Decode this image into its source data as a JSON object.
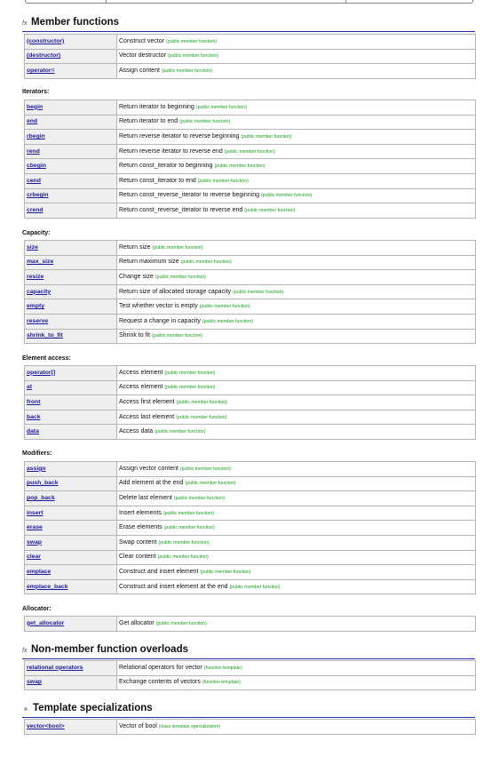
{
  "sections": [
    {
      "title": "Member functions",
      "icon": "fx-icon",
      "groups": [
        {
          "label": "",
          "rows": [
            {
              "name": "(constructor)",
              "desc": "Construct vector",
              "tag": "(public member function)"
            },
            {
              "name": "(destructor)",
              "desc": "Vector destructor",
              "tag": "(public member function)"
            },
            {
              "name": "operator=",
              "desc": "Assign content",
              "tag": "(public member function)"
            }
          ]
        },
        {
          "label": "Iterators:",
          "rows": [
            {
              "name": "begin",
              "desc": "Return iterator to beginning",
              "tag": "(public member function)"
            },
            {
              "name": "end",
              "desc": "Return iterator to end",
              "tag": "(public member function)"
            },
            {
              "name": "rbegin",
              "desc": "Return reverse iterator to reverse beginning",
              "tag": "(public member function)"
            },
            {
              "name": "rend",
              "desc": "Return reverse iterator to reverse end",
              "tag": "(public member function)"
            },
            {
              "name": "cbegin",
              "desc": "Return const_iterator to beginning",
              "tag": "(public member function)"
            },
            {
              "name": "cend",
              "desc": "Return const_iterator to end",
              "tag": "(public member function)"
            },
            {
              "name": "crbegin",
              "desc": "Return const_reverse_iterator to reverse beginning",
              "tag": "(public member function)"
            },
            {
              "name": "crend",
              "desc": "Return const_reverse_iterator to reverse end",
              "tag": "(public member function)"
            }
          ]
        },
        {
          "label": "Capacity:",
          "rows": [
            {
              "name": "size",
              "desc": "Return size",
              "tag": "(public member function)"
            },
            {
              "name": "max_size",
              "desc": "Return maximum size",
              "tag": "(public member function)"
            },
            {
              "name": "resize",
              "desc": "Change size",
              "tag": "(public member function)"
            },
            {
              "name": "capacity",
              "desc": "Return size of allocated storage capacity",
              "tag": "(public member function)"
            },
            {
              "name": "empty",
              "desc": "Test whether vector is empty",
              "tag": "(public member function)"
            },
            {
              "name": "reserve",
              "desc": "Request a change in capacity",
              "tag": "(public member function)"
            },
            {
              "name": "shrink_to_fit",
              "desc": "Shrink to fit",
              "tag": "(public member function)"
            }
          ]
        },
        {
          "label": "Element access:",
          "rows": [
            {
              "name": "operator[]",
              "desc": "Access element",
              "tag": "(public member function)"
            },
            {
              "name": "at",
              "desc": "Access element",
              "tag": "(public member function)"
            },
            {
              "name": "front",
              "desc": "Access first element",
              "tag": "(public member function)"
            },
            {
              "name": "back",
              "desc": "Access last element",
              "tag": "(public member function)"
            },
            {
              "name": "data",
              "desc": "Access data",
              "tag": "(public member function)"
            }
          ]
        },
        {
          "label": "Modifiers:",
          "rows": [
            {
              "name": "assign",
              "desc": "Assign vector content",
              "tag": "(public member function)"
            },
            {
              "name": "push_back",
              "desc": "Add element at the end",
              "tag": "(public member function)"
            },
            {
              "name": "pop_back",
              "desc": "Delete last element",
              "tag": "(public member function)"
            },
            {
              "name": "insert",
              "desc": "Insert elements",
              "tag": "(public member function)"
            },
            {
              "name": "erase",
              "desc": "Erase elements",
              "tag": "(public member function)"
            },
            {
              "name": "swap",
              "desc": "Swap content",
              "tag": "(public member function)"
            },
            {
              "name": "clear",
              "desc": "Clear content",
              "tag": "(public member function)"
            },
            {
              "name": "emplace",
              "desc": "Construct and insert element",
              "tag": "(public member function)"
            },
            {
              "name": "emplace_back",
              "desc": "Construct and insert element at the end",
              "tag": "(public member function)"
            }
          ]
        },
        {
          "label": "Allocator:",
          "rows": [
            {
              "name": "get_allocator",
              "desc": "Get allocator",
              "tag": "(public member function)"
            }
          ]
        }
      ]
    },
    {
      "title": "Non-member function overloads",
      "icon": "fx-icon",
      "groups": [
        {
          "label": "",
          "rows": [
            {
              "name": "relational operators",
              "desc": "Relational operators for vector",
              "tag": "(function template)"
            },
            {
              "name": "swap",
              "desc": "Exchange contents of vectors",
              "tag": "(function template)"
            }
          ]
        }
      ]
    },
    {
      "title": "Template specializations",
      "icon": "bullet-icon",
      "groups": [
        {
          "label": "",
          "rows": [
            {
              "name": "vector<bool>",
              "desc": "Vector of bool",
              "tag": "(class template specialization)"
            }
          ]
        }
      ]
    }
  ]
}
